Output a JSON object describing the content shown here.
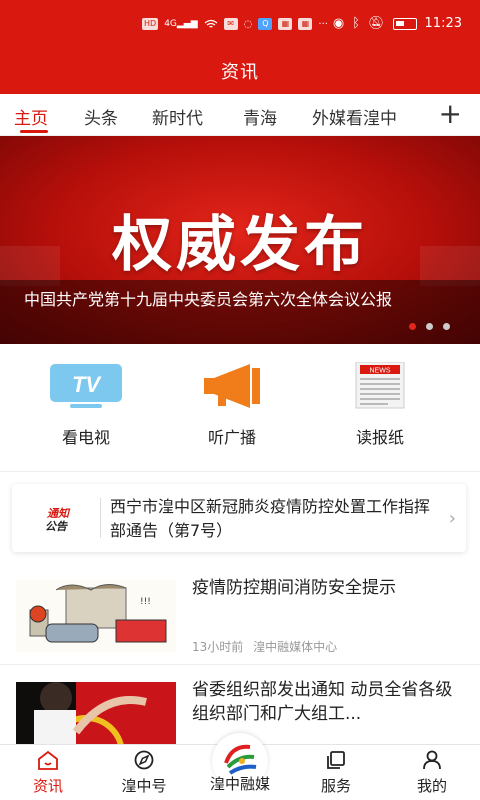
{
  "status_bar": {
    "time": "11:23",
    "indicators": [
      "HD",
      "4G",
      "wifi-icon",
      "message-icon",
      "chat-icon",
      "search-app-icon",
      "app-icon",
      "app-icon",
      "more-icon"
    ],
    "system_icons": [
      "eye-icon",
      "bluetooth-icon",
      "mute-icon",
      "battery-icon"
    ]
  },
  "header": {
    "title": "资讯"
  },
  "tabs": {
    "items": [
      {
        "label": "主页",
        "active": true
      },
      {
        "label": "头条",
        "active": false
      },
      {
        "label": "新时代",
        "active": false
      },
      {
        "label": "青海",
        "active": false
      },
      {
        "label": "外媒看湟中",
        "active": false
      }
    ],
    "add_icon": "+"
  },
  "banner": {
    "headline": "权威发布",
    "caption": "中国共产党第十九届中央委员会第六次全体会议公报",
    "slide_count": 3,
    "active_slide": 1
  },
  "quick_links": [
    {
      "label": "看电视",
      "icon": "tv-icon",
      "icon_text": "TV"
    },
    {
      "label": "听广播",
      "icon": "megaphone-icon"
    },
    {
      "label": "读报纸",
      "icon": "newspaper-icon",
      "icon_text": "NEWS"
    }
  ],
  "notice": {
    "logo_text": "通知公告",
    "text": "西宁市湟中区新冠肺炎疫情防控处置工作指挥部通告（第7号）"
  },
  "news": [
    {
      "title": "疫情防控期间消防安全提示",
      "time": "13小时前",
      "source": "湟中融媒体中心"
    },
    {
      "title": "省委组织部发出通知  动员全省各级组织部门和广大组工...",
      "time": "",
      "source": ""
    }
  ],
  "bottom_nav": [
    {
      "label": "资讯",
      "icon": "home-icon",
      "active": true
    },
    {
      "label": "湟中号",
      "icon": "compass-icon",
      "active": false
    },
    {
      "label": "湟中融媒",
      "icon": "logo-icon",
      "active": false
    },
    {
      "label": "服务",
      "icon": "copy-icon",
      "active": false
    },
    {
      "label": "我的",
      "icon": "user-icon",
      "active": false
    }
  ],
  "colors": {
    "brand_red": "#d9180f",
    "text_dark": "#222222",
    "meta_gray": "#999999"
  }
}
